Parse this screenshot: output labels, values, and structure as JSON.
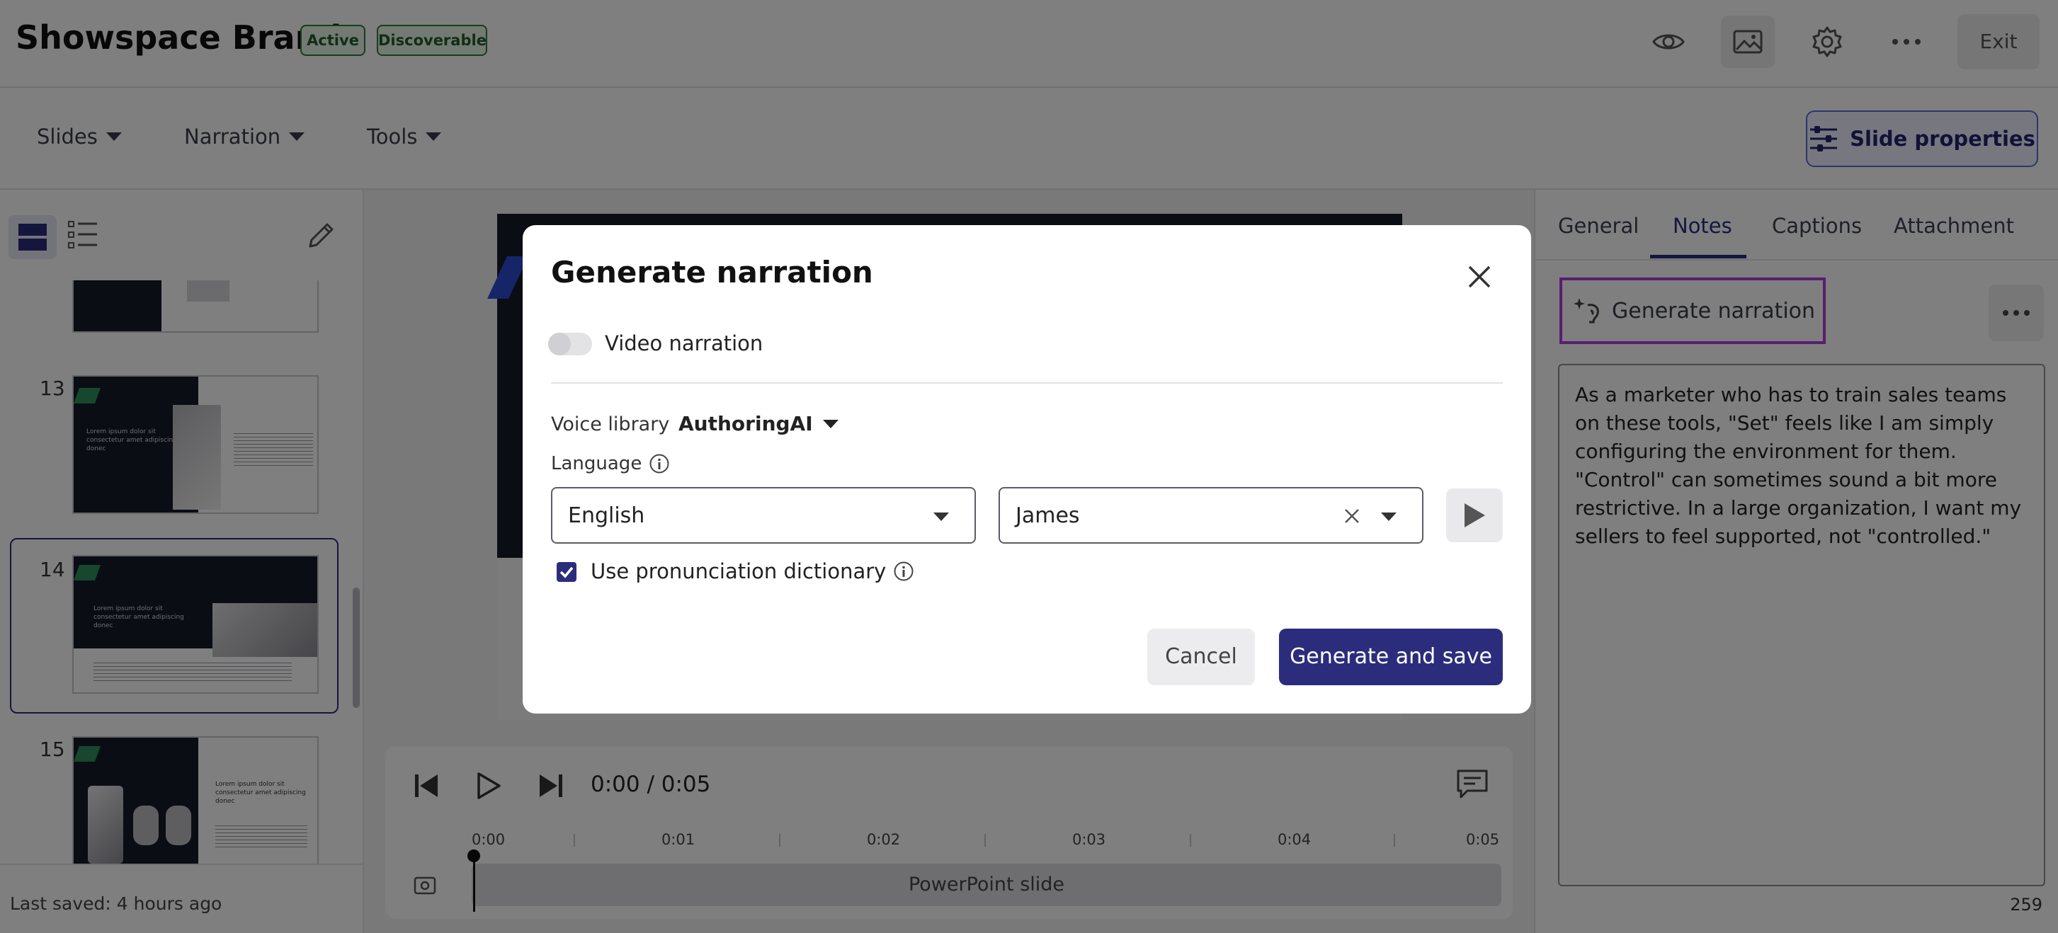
{
  "header": {
    "title": "Showspace Brand",
    "badges": [
      "Active",
      "Discoverable"
    ],
    "icons": [
      "eye-icon",
      "image-icon",
      "gear-icon",
      "more-icon"
    ],
    "exit_label": "Exit"
  },
  "toolbar": {
    "menus": [
      "Slides",
      "Narration",
      "Tools"
    ],
    "slide_properties_label": "Slide properties"
  },
  "sidebar": {
    "view_icons": [
      "grid-view-icon",
      "list-view-icon",
      "pencil-icon"
    ],
    "slides": [
      {
        "number": "",
        "text": ""
      },
      {
        "number": "13",
        "text": "Lorem ipsum dolor sit consectetur amet adipiscing donec"
      },
      {
        "number": "14",
        "text": "Lorem ipsum dolor sit consectetur amet adipiscing donec"
      },
      {
        "number": "15",
        "text": "Lorem ipsum dolor sit consectetur amet adipiscing donec"
      }
    ],
    "last_saved": "Last saved: 4 hours ago"
  },
  "player": {
    "time": "0:00 / 0:05",
    "ticks": [
      "0:00",
      "0:01",
      "0:02",
      "0:03",
      "0:04",
      "0:05"
    ],
    "track_label": "PowerPoint slide"
  },
  "right_panel": {
    "tabs": [
      "General",
      "Notes",
      "Captions",
      "Attachment"
    ],
    "active_tab": "Notes",
    "generate_narration_label": "Generate narration",
    "notes_text": "As a marketer who has to train sales teams on these tools, \"Set\" feels like I am simply configuring the environment for them. \"Control\" can sometimes sound a bit more restrictive. In a large organization, I want my sellers to feel supported, not \"controlled.\"",
    "char_count": "259"
  },
  "modal": {
    "title": "Generate narration",
    "video_narration_label": "Video narration",
    "video_narration_on": false,
    "voice_library_label": "Voice library",
    "voice_library_value": "AuthoringAI",
    "language_label": "Language",
    "language_value": "English",
    "voice_value": "James",
    "pronunciation_label": "Use pronunciation dictionary",
    "pronunciation_checked": true,
    "cancel_label": "Cancel",
    "generate_label": "Generate and save"
  },
  "colors": {
    "primary": "#2b2d7c",
    "highlight": "#b23adf",
    "badge_green": "#2c7a3e"
  }
}
